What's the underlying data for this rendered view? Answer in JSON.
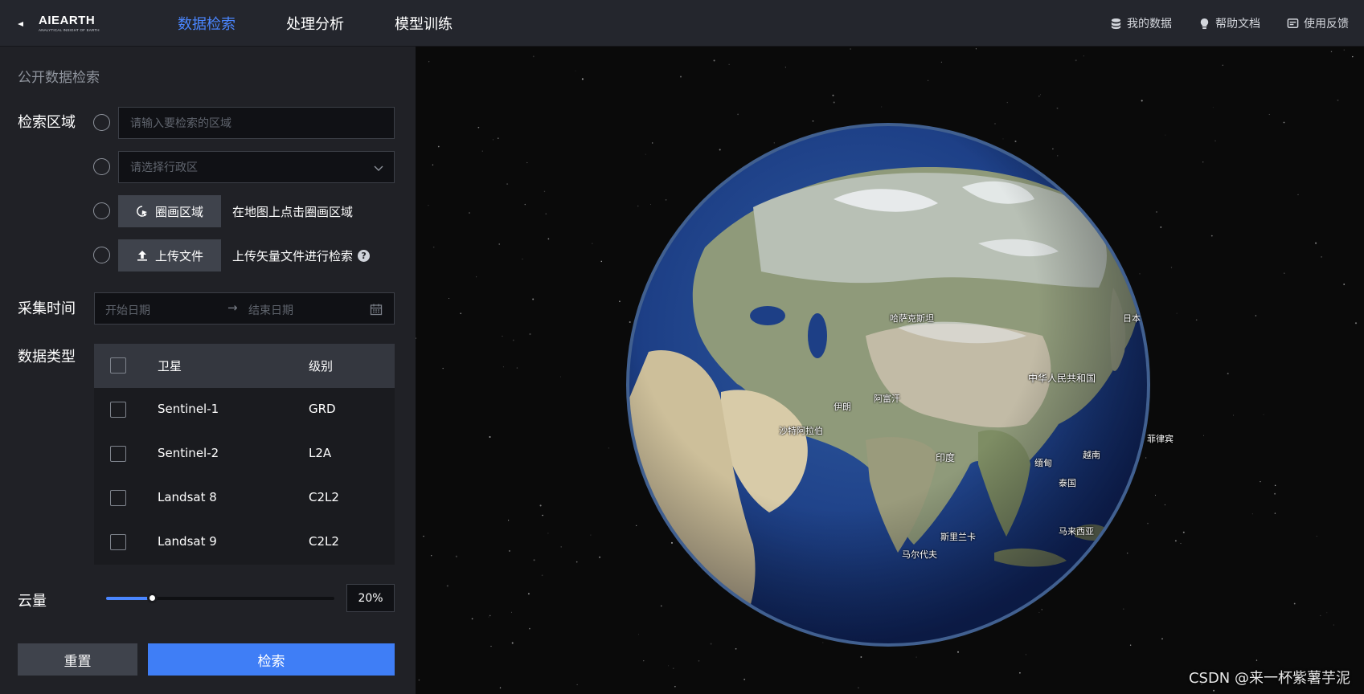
{
  "header": {
    "logo_text": "AIEARTH",
    "logo_tagline": "ANALYTICAL INSIGHT OF EARTH",
    "tabs": [
      {
        "label": "数据检索",
        "active": true
      },
      {
        "label": "处理分析",
        "active": false
      },
      {
        "label": "模型训练",
        "active": false
      }
    ],
    "utilities": [
      {
        "label": "我的数据",
        "icon": "database-icon"
      },
      {
        "label": "帮助文档",
        "icon": "lightbulb-icon"
      },
      {
        "label": "使用反馈",
        "icon": "feedback-icon"
      }
    ],
    "accent_color": "#4a86ff"
  },
  "panel": {
    "title": "公开数据检索",
    "search_area": {
      "label": "检索区域",
      "region_input_placeholder": "请输入要检索的区域",
      "admin_select_placeholder": "请选择行政区",
      "draw_button_label": "圈画区域",
      "draw_hint": "在地图上点击圈画区域",
      "upload_button_label": "上传文件",
      "upload_hint": "上传矢量文件进行检索"
    },
    "time": {
      "label": "采集时间",
      "start_placeholder": "开始日期",
      "separator": "→",
      "end_placeholder": "结束日期"
    },
    "data_type": {
      "label": "数据类型",
      "columns": [
        "卫星",
        "级别"
      ],
      "rows": [
        {
          "satellite": "Sentinel-1",
          "level": "GRD",
          "checked": false
        },
        {
          "satellite": "Sentinel-2",
          "level": "L2A",
          "checked": false
        },
        {
          "satellite": "Landsat 8",
          "level": "C2L2",
          "checked": false
        },
        {
          "satellite": "Landsat 9",
          "level": "C2L2",
          "checked": false
        }
      ]
    },
    "cloud": {
      "label": "云量",
      "value": 20,
      "max": 100,
      "value_text": "20%"
    },
    "reset_label": "重置",
    "search_label": "检索"
  },
  "map": {
    "labels": [
      "中华人民共和国",
      "印度",
      "斯里兰卡",
      "马尔代夫",
      "哈萨克斯坦",
      "阿富汗",
      "伊朗",
      "沙特阿拉伯",
      "泰国",
      "缅甸",
      "越南",
      "日本",
      "菲律宾",
      "马来西亚"
    ],
    "watermark": "CSDN @来一杯紫薯芋泥"
  }
}
